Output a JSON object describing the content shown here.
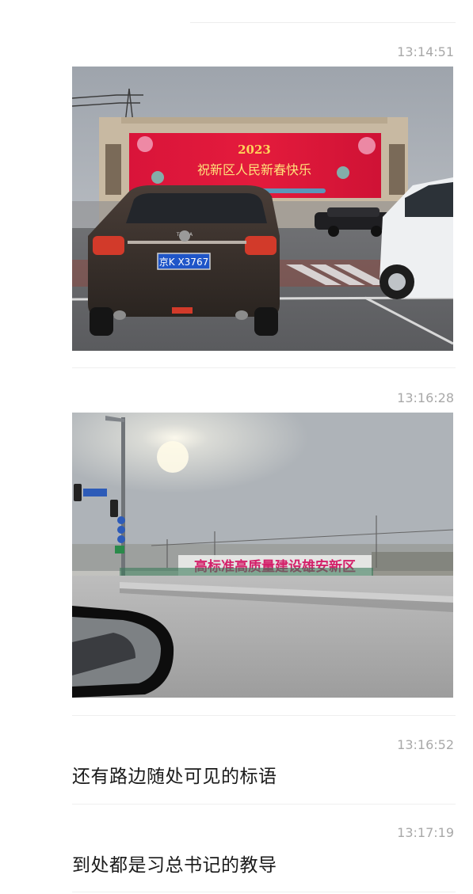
{
  "messages": [
    {
      "time": "13:14:51",
      "type": "image",
      "image_text": {
        "banner_year": "2023",
        "banner_greeting": "祝新区人民新春快乐",
        "plate": "京K X3767",
        "car_badge": "TEANA"
      }
    },
    {
      "time": "13:16:28",
      "type": "image",
      "image_text": {
        "roadside_slogan": "高标准高质量建设雄安新区"
      }
    },
    {
      "time": "13:16:52",
      "type": "text",
      "text": "还有路边随处可见的标语"
    },
    {
      "time": "13:17:19",
      "type": "text",
      "text": "到处都是习总书记的教导"
    }
  ]
}
